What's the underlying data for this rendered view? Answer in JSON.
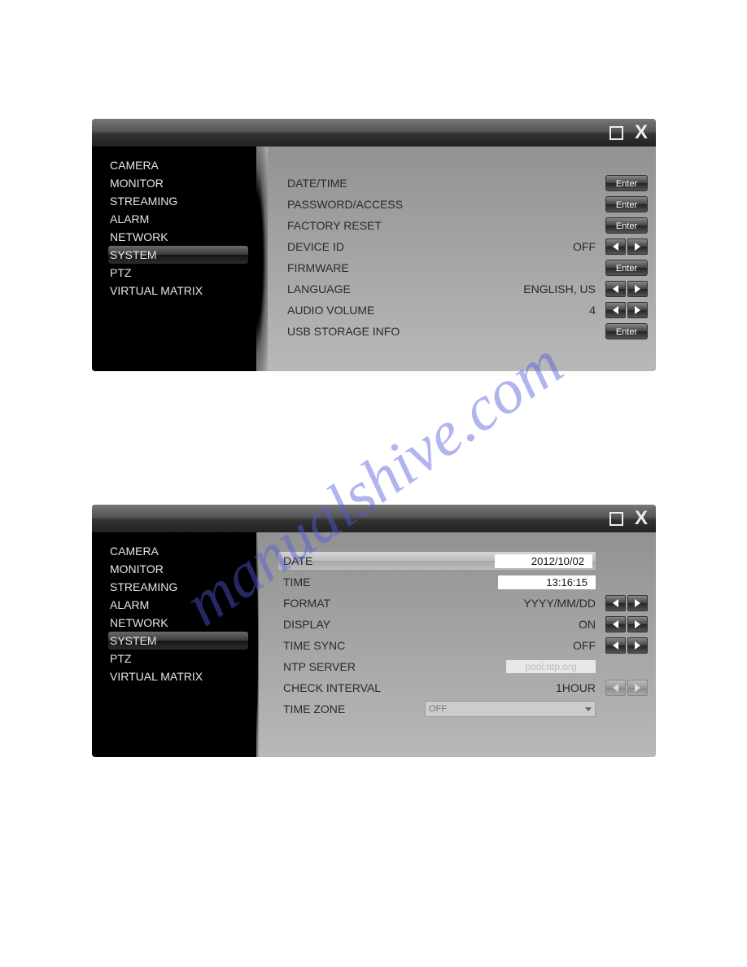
{
  "watermark": "manualshive.com",
  "sidebar": {
    "items": [
      "CAMERA",
      "MONITOR",
      "STREAMING",
      "ALARM",
      "NETWORK",
      "SYSTEM",
      "PTZ",
      "VIRTUAL MATRIX"
    ],
    "selected_index": 5
  },
  "panel1": {
    "rows": [
      {
        "label": "DATE/TIME",
        "value": "",
        "ctrl": "enter"
      },
      {
        "label": "PASSWORD/ACCESS",
        "value": "",
        "ctrl": "enter"
      },
      {
        "label": "FACTORY RESET",
        "value": "",
        "ctrl": "enter"
      },
      {
        "label": "DEVICE ID",
        "value": "OFF",
        "ctrl": "arrows"
      },
      {
        "label": "FIRMWARE",
        "value": "",
        "ctrl": "enter"
      },
      {
        "label": "LANGUAGE",
        "value": "ENGLISH, US",
        "ctrl": "arrows"
      },
      {
        "label": "AUDIO VOLUME",
        "value": "4",
        "ctrl": "arrows"
      },
      {
        "label": "USB STORAGE INFO",
        "value": "",
        "ctrl": "enter"
      }
    ]
  },
  "panel2": {
    "date_label": "DATE",
    "date_value": "2012/10/02",
    "time_label": "TIME",
    "time_value": "13:16:15",
    "rows": [
      {
        "label": "FORMAT",
        "value": "YYYY/MM/DD",
        "ctrl": "arrows"
      },
      {
        "label": "DISPLAY",
        "value": "ON",
        "ctrl": "arrows"
      },
      {
        "label": "TIME SYNC",
        "value": "OFF",
        "ctrl": "arrows"
      }
    ],
    "ntp_label": "NTP SERVER",
    "ntp_value": "pool.ntp.org",
    "check_label": "CHECK INTERVAL",
    "check_value": "1HOUR",
    "tz_label": "TIME ZONE",
    "tz_value": "OFF"
  },
  "buttons": {
    "enter": "Enter"
  }
}
